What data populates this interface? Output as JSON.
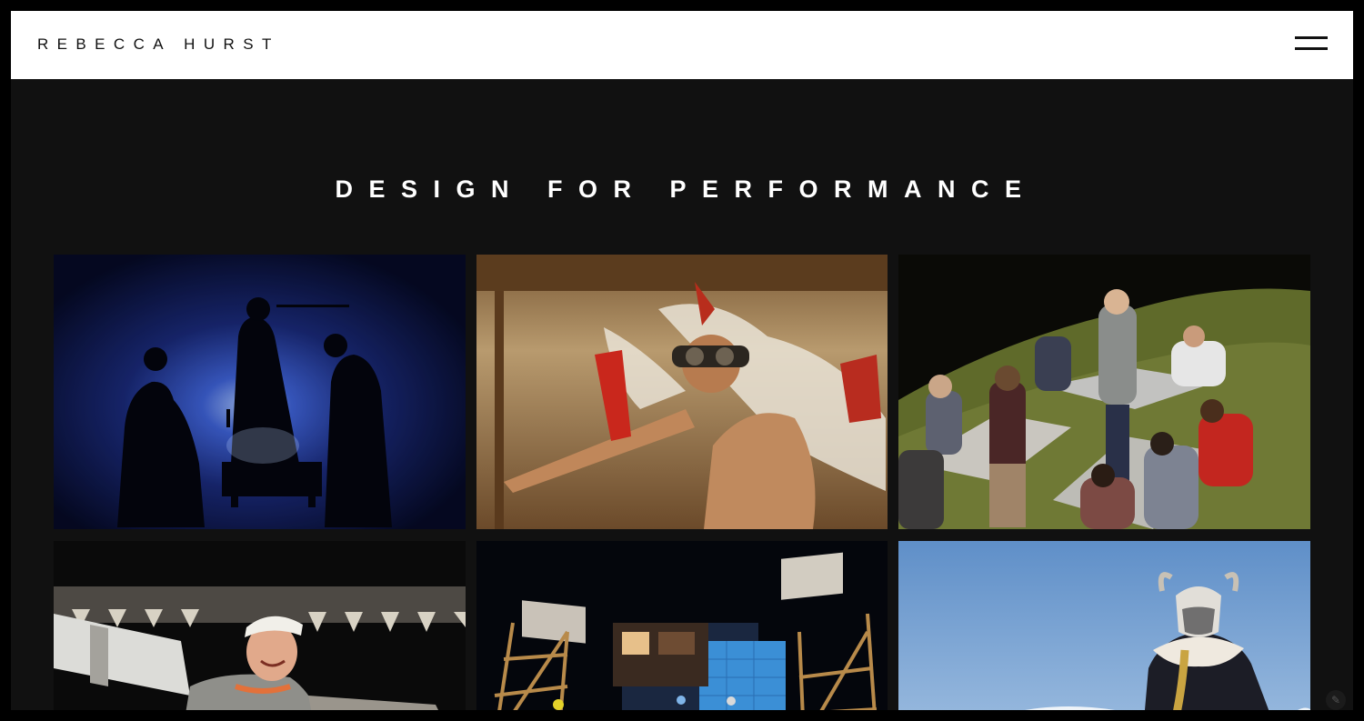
{
  "site": {
    "brand": "REBECCA HURST"
  },
  "header": {
    "menu_icon": "hamburger-menu-icon"
  },
  "main": {
    "title": "DESIGN FOR PERFORMANCE",
    "gallery": [
      {
        "scene": "silhouetted-performers-blue-backlight"
      },
      {
        "scene": "winged-aviator-with-goggles"
      },
      {
        "scene": "students-at-tables-on-grass-mound"
      },
      {
        "scene": "smiling-woman-in-sailor-hat"
      },
      {
        "scene": "scaffold-towers-stage-set"
      },
      {
        "scene": "masked-saxophonist-against-sky"
      }
    ]
  },
  "footer_icon": "pencil-icon",
  "colors": {
    "background": "#000000",
    "panel": "#111111",
    "header": "#ffffff",
    "title": "#ffffff"
  }
}
